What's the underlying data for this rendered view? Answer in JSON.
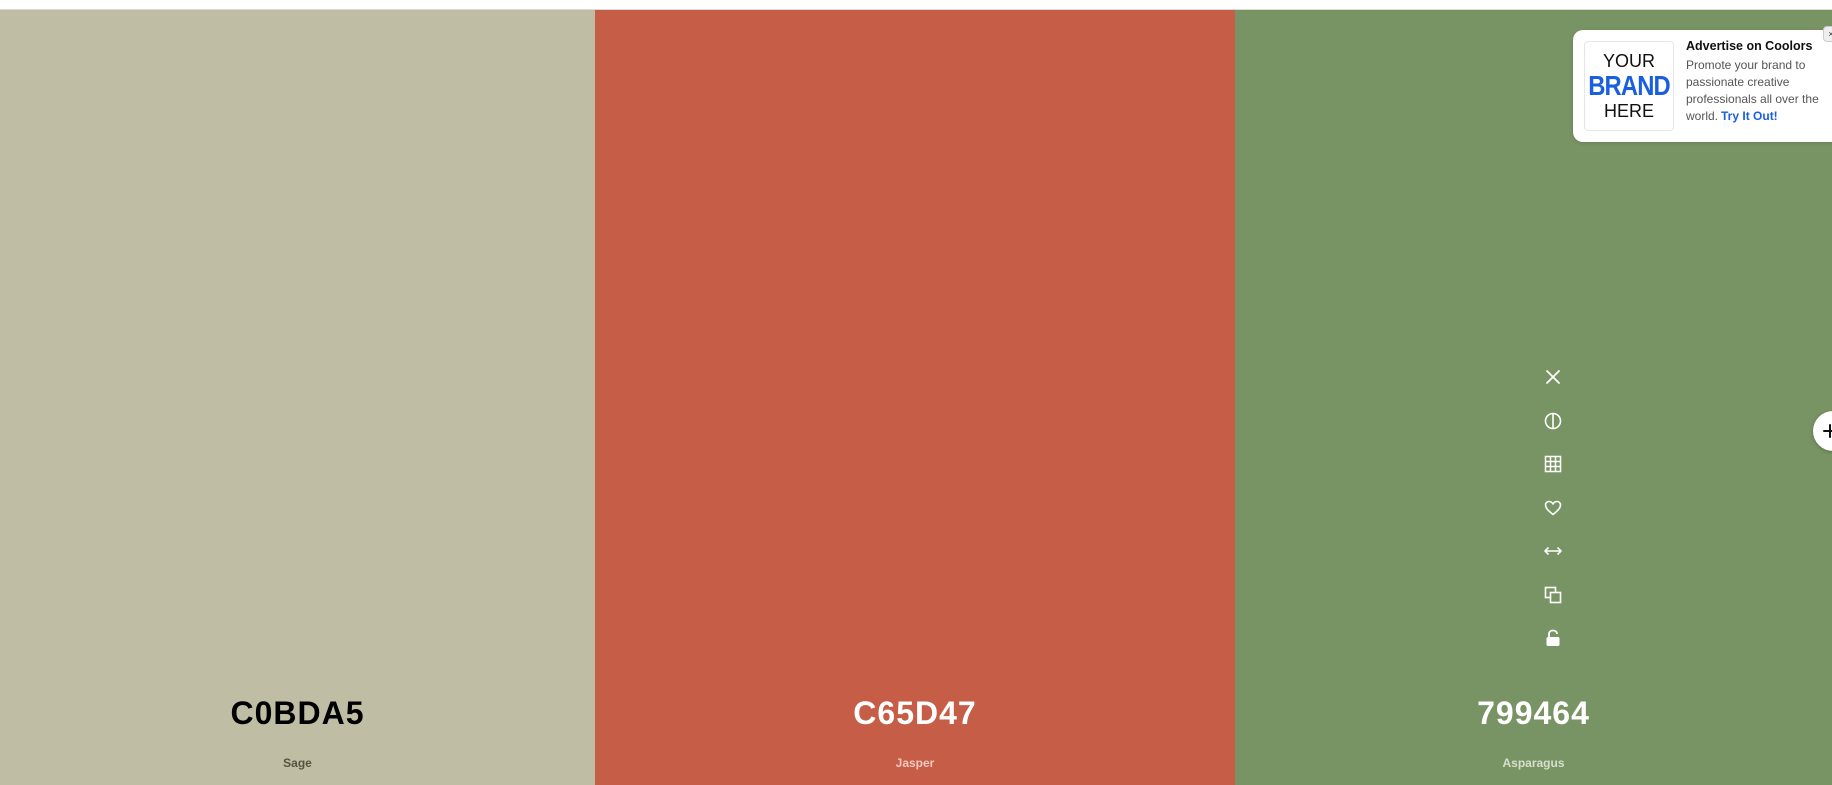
{
  "swatches": [
    {
      "hex": "C0BDA5",
      "name": "Sage",
      "color": "#C0BDA5"
    },
    {
      "hex": "C65D47",
      "name": "Jasper",
      "color": "#C65D47"
    },
    {
      "hex": "799464",
      "name": "Asparagus",
      "color": "#799464"
    }
  ],
  "tools": [
    {
      "name": "remove-icon",
      "label": "Remove color"
    },
    {
      "name": "contrast-icon",
      "label": "Shades"
    },
    {
      "name": "grid-icon",
      "label": "View shades"
    },
    {
      "name": "heart-icon",
      "label": "Save color"
    },
    {
      "name": "drag-icon",
      "label": "Drag"
    },
    {
      "name": "copy-icon",
      "label": "Copy hex"
    },
    {
      "name": "unlock-icon",
      "label": "Lock color"
    }
  ],
  "ad": {
    "logo_line1": "YOUR",
    "logo_line2": "BRAND",
    "logo_line3": "HERE",
    "title": "Advertise on Coolors",
    "body": "Promote your brand to passionate creative professionals all over the world.",
    "link": "Try It Out!",
    "close": "×"
  },
  "add_button": {
    "icon": "plus-icon"
  }
}
